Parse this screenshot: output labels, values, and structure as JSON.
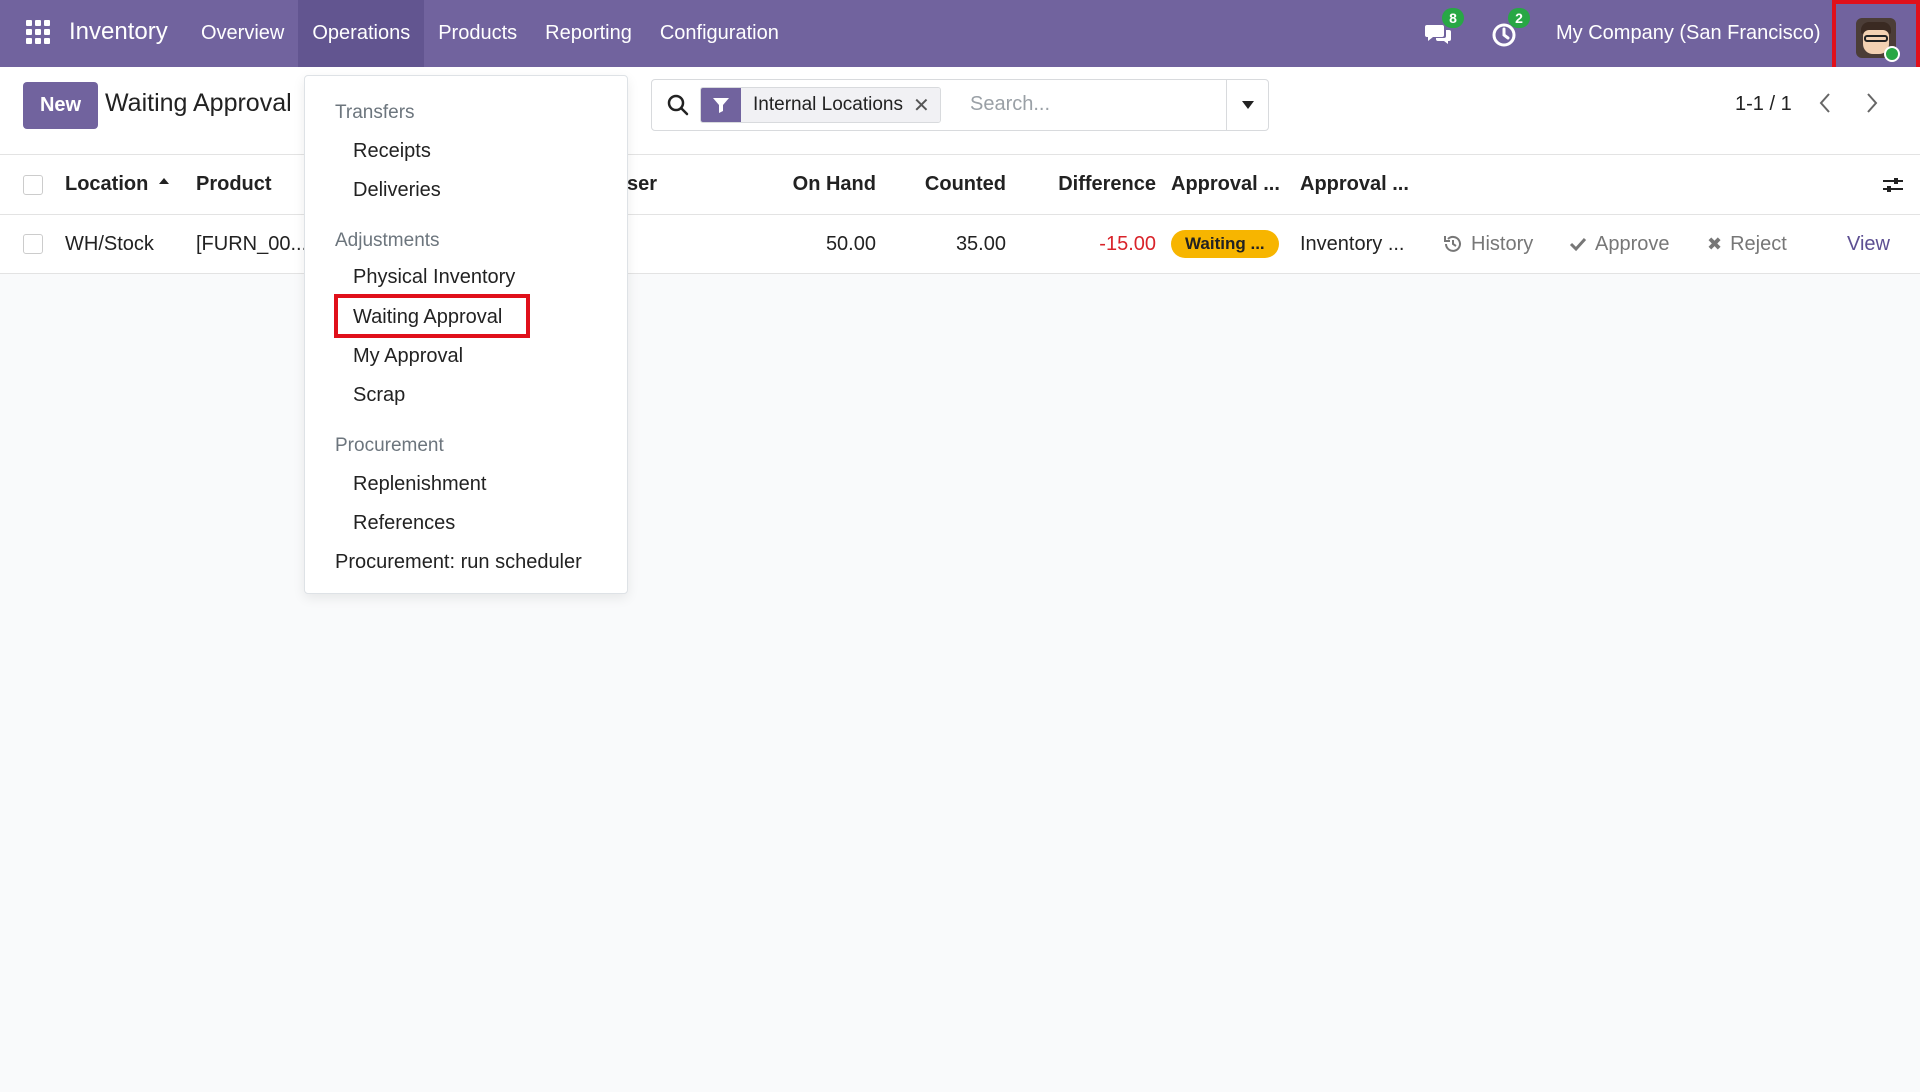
{
  "navbar": {
    "app_name": "Inventory",
    "menu": [
      {
        "label": "Overview"
      },
      {
        "label": "Operations"
      },
      {
        "label": "Products"
      },
      {
        "label": "Reporting"
      },
      {
        "label": "Configuration"
      }
    ],
    "messages_count": "8",
    "activities_count": "2",
    "company": "My Company (San Francisco)"
  },
  "control": {
    "new_label": "New",
    "title": "Waiting Approval",
    "facet_label": "Internal Locations",
    "search_placeholder": "Search...",
    "pager": "1-1 / 1"
  },
  "list": {
    "headers": {
      "location": "Location",
      "product": "Product",
      "user": "ser",
      "on_hand": "On Hand",
      "counted": "Counted",
      "difference": "Difference",
      "approval1": "Approval ...",
      "approval2": "Approval ..."
    },
    "rows": [
      {
        "location": "WH/Stock",
        "product": "[FURN_00...",
        "on_hand": "50.00",
        "counted": "35.00",
        "difference": "-15.00",
        "status": "Waiting ...",
        "approval": "Inventory ...",
        "history": "History",
        "approve": "Approve",
        "reject": "Reject",
        "view": "View"
      }
    ]
  },
  "dropdown": {
    "sections": [
      {
        "header": "Transfers",
        "items": [
          "Receipts",
          "Deliveries"
        ]
      },
      {
        "header": "Adjustments",
        "items": [
          "Physical Inventory",
          "Waiting Approval",
          "My Approval",
          "Scrap"
        ]
      },
      {
        "header": "Procurement",
        "items": [
          "Replenishment",
          "References"
        ]
      }
    ],
    "footer_item": "Procurement: run scheduler"
  },
  "colors": {
    "navbar": "#71639e",
    "accent": "#71639e",
    "negative": "#d9232a",
    "status_waiting": "#f7b500",
    "highlight": "#e0101a"
  }
}
